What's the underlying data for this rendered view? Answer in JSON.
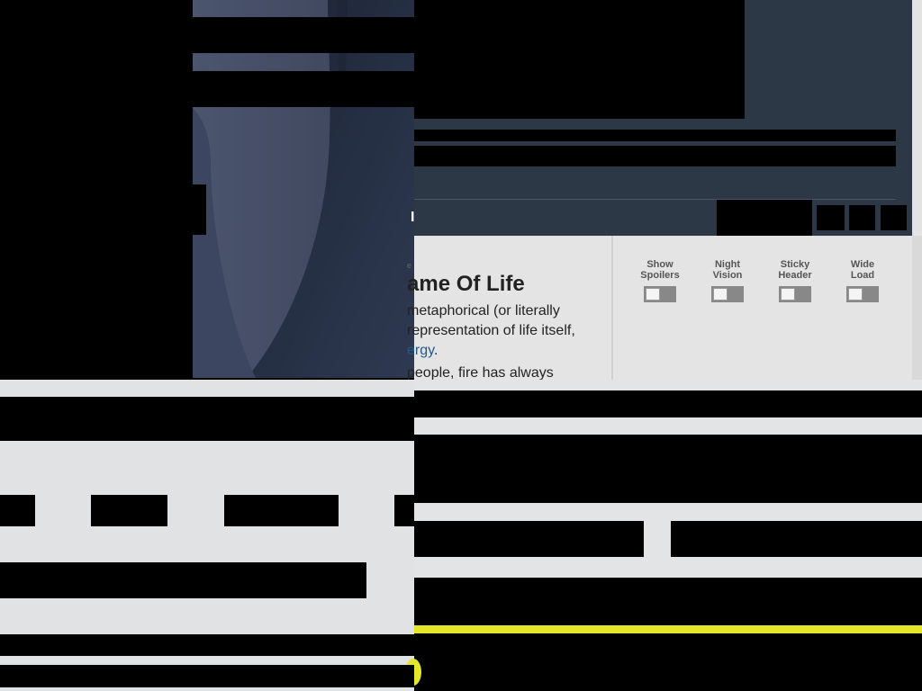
{
  "article": {
    "kicker": "e",
    "title": "ame Of Life",
    "lines": [
      "metaphorical (or literally",
      "representation of life itself,"
    ],
    "link_text": "ergy",
    "link_suffix": ".",
    "trailing_line": "people, fire has always"
  },
  "settings": {
    "toggles": [
      {
        "line1": "Show",
        "line2": "Spoilers",
        "on": false
      },
      {
        "line1": "Night",
        "line2": "Vision",
        "on": false
      },
      {
        "line1": "Sticky",
        "line2": "Header",
        "on": false
      },
      {
        "line1": "Wide",
        "line2": "Load",
        "on": false
      }
    ]
  },
  "header": {
    "menu_glyph": "I"
  },
  "colors": {
    "header_bg": "#2d3847",
    "content_bg": "#e4e4e4",
    "link": "#1d5b8c",
    "accent_yellow": "#e5e52a"
  }
}
